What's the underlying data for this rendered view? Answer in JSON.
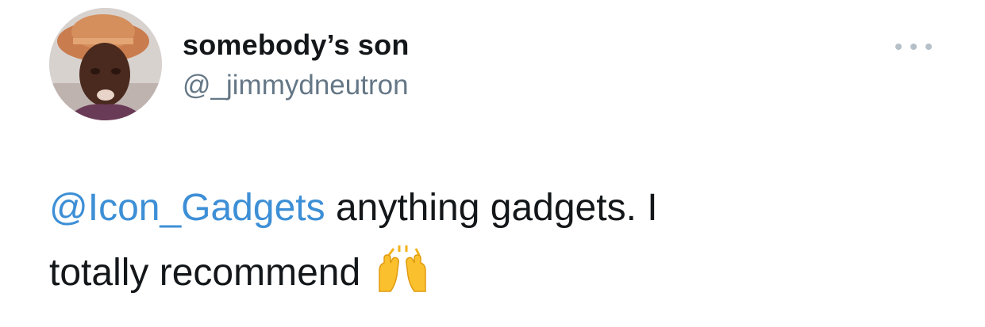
{
  "tweet": {
    "author": {
      "display_name": "somebody’s son",
      "handle": "@_jimmydneutron"
    },
    "more_icon": "ellipsis-icon",
    "text": {
      "mention": "@Icon_Gadgets",
      "line1_rest": " anything gadgets. I",
      "line2": "totally recommend",
      "emoji": "raising-hands-emoji"
    },
    "colors": {
      "mention": "#3d8fd6",
      "handle": "#657786",
      "text": "#14171a",
      "more_dots": "#b6c0c8"
    }
  }
}
